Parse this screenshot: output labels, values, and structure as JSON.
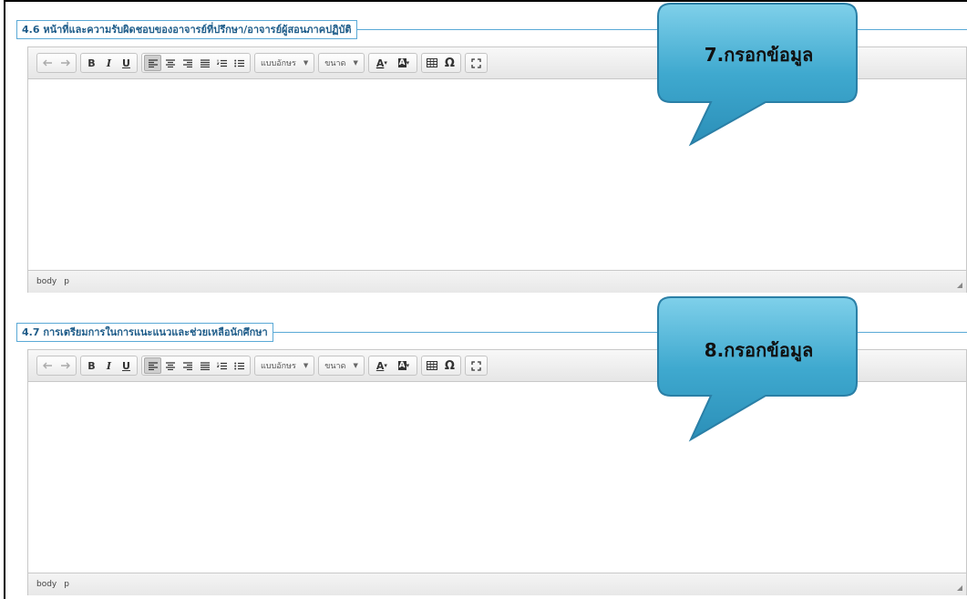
{
  "sections": [
    {
      "legend": "4.6 หน้าที่และความรับผิดชอบของอาจารย์ที่ปรึกษา/อาจารย์ผู้สอนภาคปฏิบัติ",
      "statusbar": [
        "body",
        "p"
      ],
      "callout": "7.กรอกข้อมูล"
    },
    {
      "legend": "4.7 การเตรียมการในการแนะแนวและช่วยเหลือนักศึกษา",
      "statusbar": [
        "body",
        "p"
      ],
      "callout": "8.กรอกข้อมูล"
    }
  ],
  "toolbar": {
    "bold": "B",
    "italic": "I",
    "underline": "U",
    "font_dropdown": "แบบอักษร",
    "size_dropdown": "ขนาด",
    "text_color": "A",
    "bg_color": "A",
    "special_char": "Ω",
    "icons": [
      "undo-icon",
      "redo-icon",
      "align-left-icon",
      "align-center-icon",
      "align-right-icon",
      "align-justify-icon",
      "numbered-list-icon",
      "bullet-list-icon",
      "table-icon",
      "fullscreen-icon"
    ]
  },
  "colors": {
    "legend_border": "#5aa9d6",
    "callout_fill": "#3ba3c9",
    "callout_border": "#2a7fa6"
  }
}
